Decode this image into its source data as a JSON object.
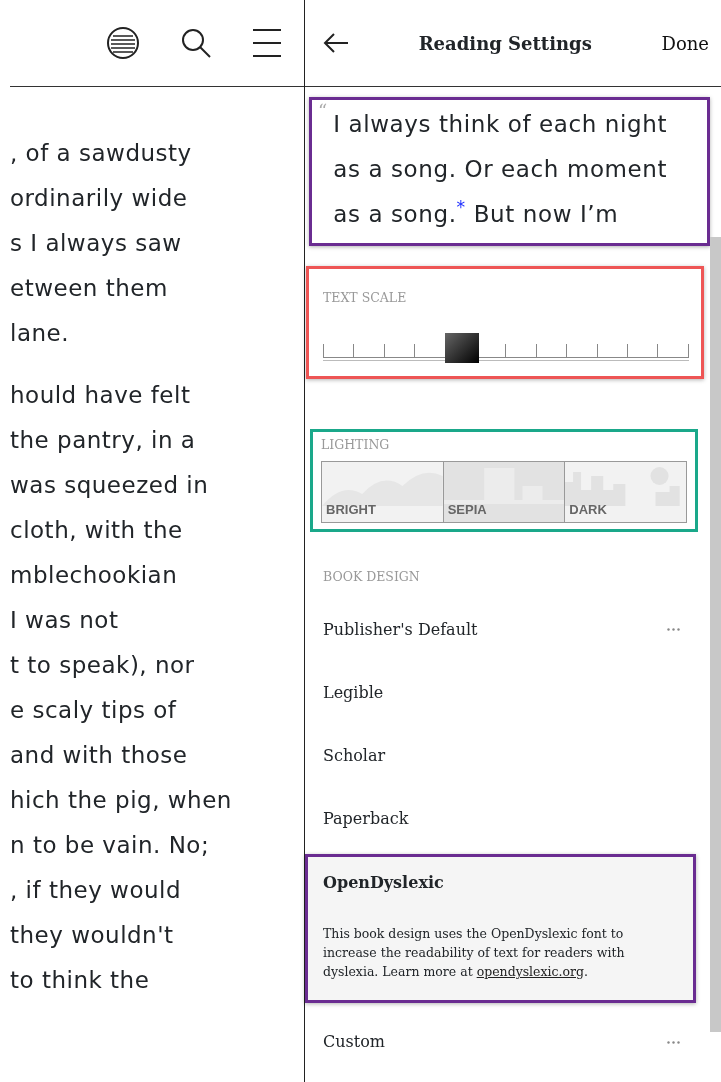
{
  "toolbar": {
    "icons": [
      {
        "kind": "contents"
      },
      {
        "kind": "search"
      },
      {
        "kind": "menu"
      }
    ]
  },
  "book_text": {
    "paragraphs": [
      [
        ", of a sawdusty",
        "ordinarily wide",
        "s I always saw",
        "etween them",
        "lane."
      ],
      [
        "hould have felt",
        "the pantry, in a",
        "was squeezed in",
        "cloth, with the",
        "mblechookian",
        "I was not",
        "t to speak), nor",
        "e scaly tips of",
        "and with those",
        "hich the pig, when",
        "n to be vain. No;",
        ", if they would",
        "they wouldn't",
        "to think the"
      ]
    ]
  },
  "settings": {
    "title": "Reading Settings",
    "done": "Done",
    "preview": {
      "quote_mark": "“",
      "lines": [
        "I always think of each night",
        "as a song. Or each moment",
        "as a song.$^{*}$ But now I’m"
      ]
    },
    "text_scale": {
      "label": "TEXT SCALE",
      "level": 0.38
    },
    "lighting": {
      "label": "LIGHTING",
      "options": [
        {
          "label": "BRIGHT",
          "kind": "bright",
          "selected": false
        },
        {
          "label": "SEPIA",
          "kind": "sepia",
          "selected": true
        },
        {
          "label": "DARK",
          "kind": "dark",
          "selected": false
        }
      ]
    },
    "book_design": {
      "label": "BOOK DESIGN",
      "items": [
        {
          "name": "Publisher's Default",
          "more": true,
          "selected": false
        },
        {
          "name": "Legible",
          "more": false,
          "selected": false
        },
        {
          "name": "Scholar",
          "more": false,
          "selected": false
        },
        {
          "name": "Paperback",
          "more": false,
          "selected": false
        },
        {
          "name": "OpenDyslexic",
          "more": false,
          "selected": true,
          "description": "This book design uses the OpenDyslexic font to increase the readability of text for readers with dyslexia. Learn more at ",
          "link": "opendyslexic.org",
          "after": "."
        },
        {
          "name": "Custom",
          "more": true,
          "selected": false
        }
      ]
    }
  }
}
